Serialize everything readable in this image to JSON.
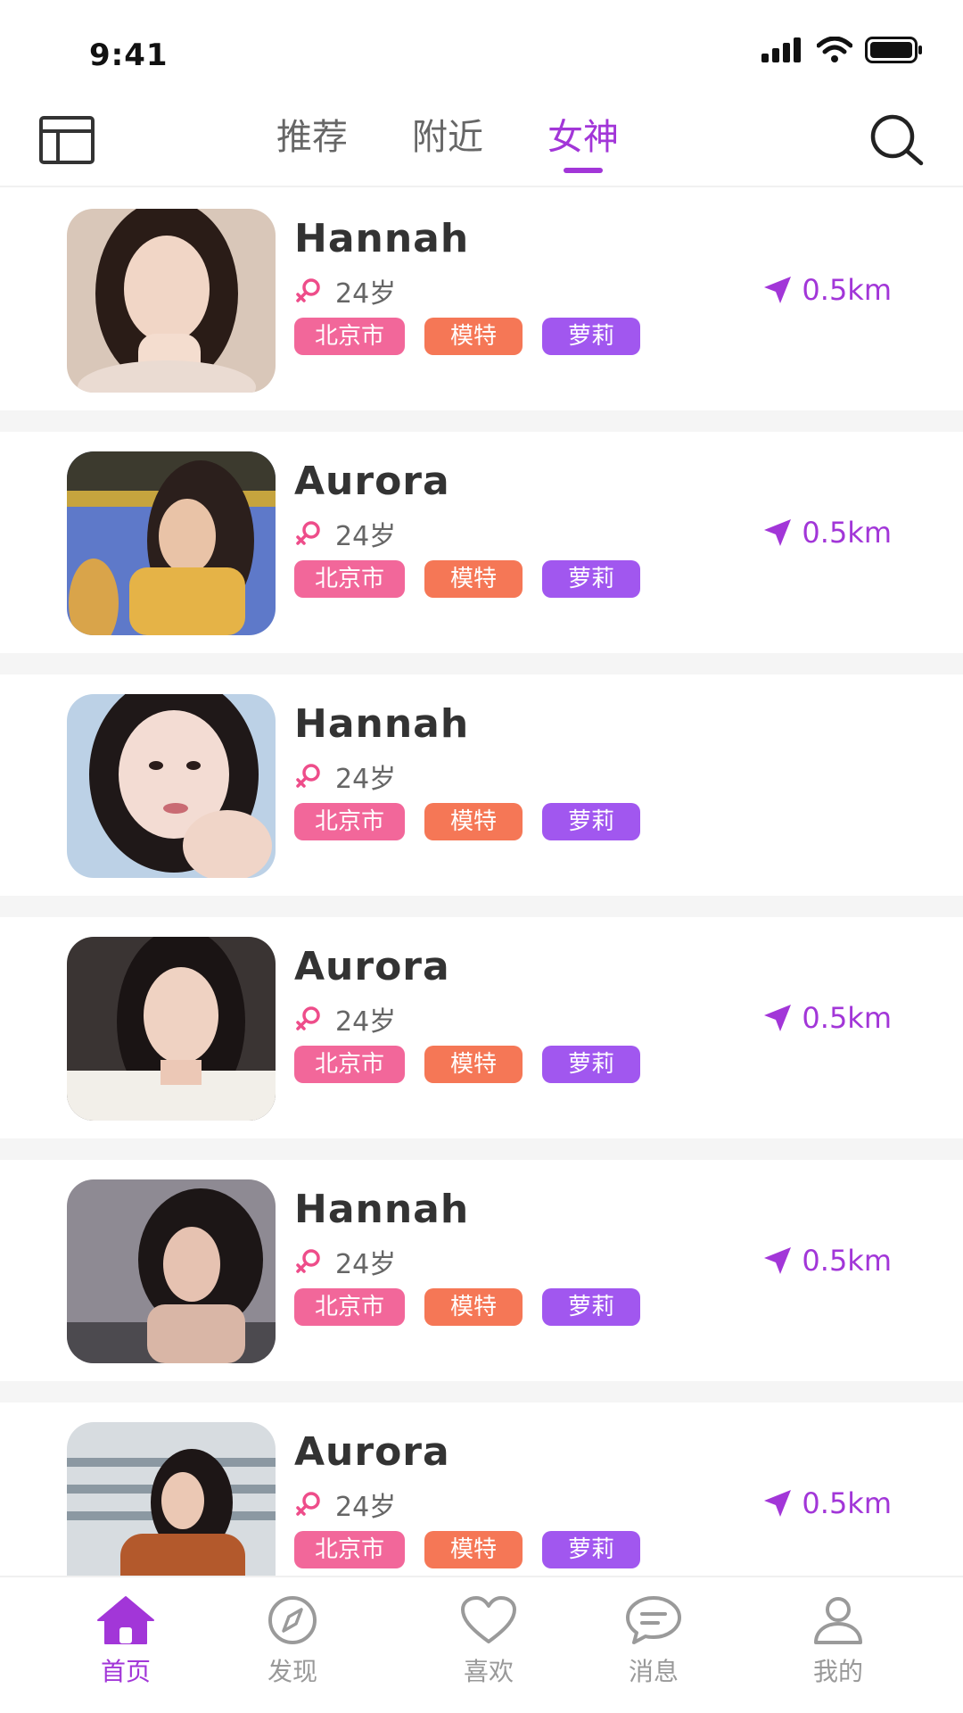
{
  "status_bar": {
    "time": "9:41"
  },
  "top_nav": {
    "tabs": [
      {
        "label": "推荐",
        "active": false
      },
      {
        "label": "附近",
        "active": false
      },
      {
        "label": "女神",
        "active": true
      }
    ]
  },
  "list": {
    "items": [
      {
        "name": "Hannah",
        "age": "24岁",
        "tags": [
          "北京市",
          "模特",
          "萝莉"
        ],
        "distance": "0.5km"
      },
      {
        "name": "Aurora",
        "age": "24岁",
        "tags": [
          "北京市",
          "模特",
          "萝莉"
        ],
        "distance": "0.5km"
      },
      {
        "name": "Hannah",
        "age": "24岁",
        "tags": [
          "北京市",
          "模特",
          "萝莉"
        ],
        "distance": ""
      },
      {
        "name": "Aurora",
        "age": "24岁",
        "tags": [
          "北京市",
          "模特",
          "萝莉"
        ],
        "distance": "0.5km"
      },
      {
        "name": "Hannah",
        "age": "24岁",
        "tags": [
          "北京市",
          "模特",
          "萝莉"
        ],
        "distance": "0.5km"
      },
      {
        "name": "Aurora",
        "age": "24岁",
        "tags": [
          "北京市",
          "模特",
          "萝莉"
        ],
        "distance": "0.5km"
      }
    ]
  },
  "bottom_nav": {
    "items": [
      {
        "label": "首页",
        "icon": "home-icon",
        "active": true
      },
      {
        "label": "发现",
        "icon": "compass-icon",
        "active": false
      },
      {
        "label": "喜欢",
        "icon": "heart-icon",
        "active": false
      },
      {
        "label": "消息",
        "icon": "message-icon",
        "active": false
      },
      {
        "label": "我的",
        "icon": "user-icon",
        "active": false
      }
    ]
  },
  "colors": {
    "accent": "#a236d8",
    "tag_city": "#f2679a",
    "tag_model": "#f57756",
    "tag_loli": "#a157ef",
    "gender": "#ee4d8a"
  }
}
